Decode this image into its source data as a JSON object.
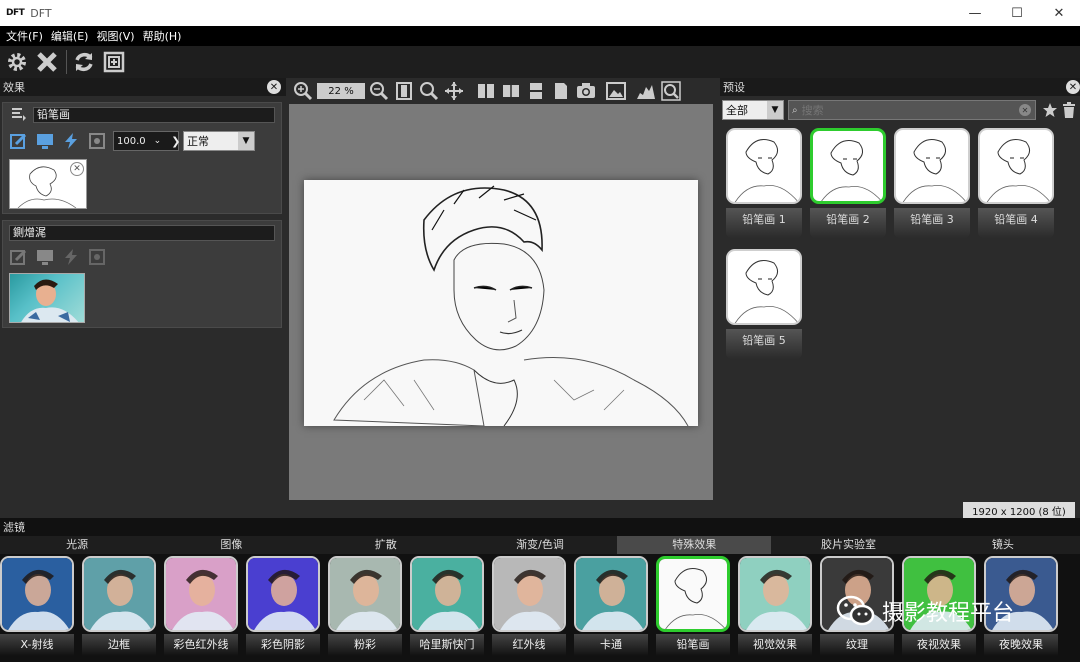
{
  "window": {
    "logo": "DFT",
    "title": "DFT",
    "minimize": "—",
    "maximize": "☐",
    "close": "✕"
  },
  "menu": [
    "文件(F)",
    "编辑(E)",
    "视图(V)",
    "帮助(H)"
  ],
  "effects_panel": {
    "title": "效果",
    "layer1": {
      "name": "铅笔画",
      "opacity": "100.0",
      "blend": "正常"
    },
    "layer2": {
      "name": "鍘熷浘"
    }
  },
  "canvas": {
    "zoom": "22 %"
  },
  "presets_panel": {
    "title": "预设",
    "filter_select": "全部",
    "search_placeholder": "搜索",
    "presets": [
      {
        "label": "铅笔画 1",
        "selected": false
      },
      {
        "label": "铅笔画 2",
        "selected": true
      },
      {
        "label": "铅笔画 3",
        "selected": false
      },
      {
        "label": "铅笔画 4",
        "selected": false
      },
      {
        "label": "铅笔画 5",
        "selected": false
      }
    ],
    "status": "1920 x 1200 (8 位)"
  },
  "filters_panel": {
    "title": "滤镜",
    "categories": [
      "光源",
      "图像",
      "扩散",
      "渐变/色调",
      "特殊效果",
      "胶片实验室",
      "镜头"
    ],
    "active_category": "特殊效果",
    "filters": [
      {
        "label": "X-射线",
        "color": "#2a5fa0",
        "selected": false
      },
      {
        "label": "边框",
        "color": "#5fa0a8",
        "selected": false
      },
      {
        "label": "彩色红外线",
        "color": "#d9a0c8",
        "selected": false
      },
      {
        "label": "彩色阴影",
        "color": "#4a3fd0",
        "selected": false
      },
      {
        "label": "粉彩",
        "color": "#a8b8b0",
        "selected": false
      },
      {
        "label": "哈里斯快门",
        "color": "#4ab0a0",
        "selected": false
      },
      {
        "label": "红外线",
        "color": "#b8b8b8",
        "selected": false
      },
      {
        "label": "卡通",
        "color": "#4aa0a0",
        "selected": false
      },
      {
        "label": "铅笔画",
        "color": "#f4f4f4",
        "selected": true
      },
      {
        "label": "视觉效果",
        "color": "#8fd0c0",
        "selected": false
      },
      {
        "label": "纹理",
        "color": "#3a3a3a",
        "selected": false
      },
      {
        "label": "夜视效果",
        "color": "#40c040",
        "selected": false
      },
      {
        "label": "夜晚效果",
        "color": "#3a5a90",
        "selected": false
      }
    ]
  },
  "watermark": "摄影教程平台"
}
